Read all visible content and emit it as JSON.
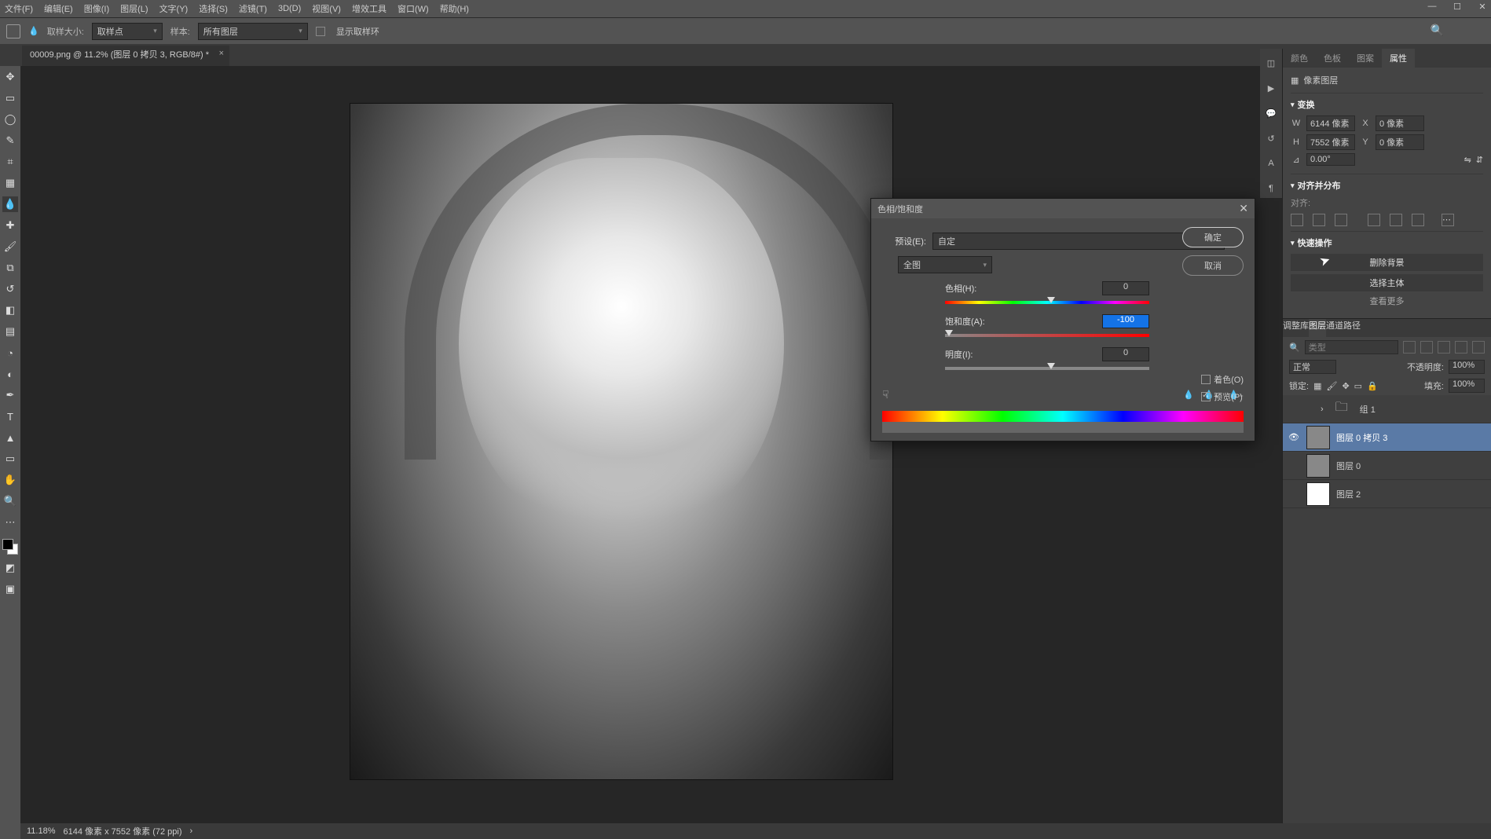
{
  "menu": {
    "file": "文件(F)",
    "edit": "编辑(E)",
    "image": "图像(I)",
    "layer": "图层(L)",
    "type": "文字(Y)",
    "select": "选择(S)",
    "filter": "滤镜(T)",
    "threeD": "3D(D)",
    "view": "视图(V)",
    "plugins": "增效工具",
    "window": "窗口(W)",
    "help": "帮助(H)"
  },
  "optbar": {
    "sampleSizeLabel": "取样大小:",
    "sampleSizeValue": "取样点",
    "sampleLabel": "样本:",
    "sampleValue": "所有图层",
    "showRing": "显示取样环"
  },
  "tab": {
    "title": "00009.png @ 11.2% (图层 0 拷贝 3, RGB/8#) *"
  },
  "dialog": {
    "title": "色相/饱和度",
    "presetLabel": "预设(E):",
    "presetValue": "自定",
    "channelValue": "全图",
    "hueLabel": "色相(H):",
    "hueValue": "0",
    "satLabel": "饱和度(A):",
    "satValue": "-100",
    "lightLabel": "明度(I):",
    "lightValue": "0",
    "ok": "确定",
    "cancel": "取消",
    "colorize": "着色(O)",
    "preview": "预览(P)"
  },
  "panels": {
    "tabs": {
      "color": "颜色",
      "swatch": "色板",
      "gradient": "图案",
      "props": "属性"
    },
    "pixelLayer": "像素图层",
    "transform": "变换",
    "w": "6144 像素",
    "h": "7552 像素",
    "x": "0 像素",
    "y": "0 像素",
    "angle": "0.00°",
    "alignDist": "对齐并分布",
    "alignLabel": "对齐:",
    "quickActions": "快速操作",
    "qa1": "删除背景",
    "qa2": "选择主体",
    "qa3": "查看更多",
    "tabs2": {
      "adjust": "调整",
      "lib": "库",
      "layers": "图层",
      "channels": "通道",
      "paths": "路径"
    },
    "layerSearchPh": "类型",
    "blend": "正常",
    "opacityLabel": "不透明度:",
    "opacityVal": "100%",
    "lockLabel": "锁定:",
    "fillLabel": "填充:",
    "fillVal": "100%",
    "layers": [
      {
        "name": "组 1",
        "type": "group"
      },
      {
        "name": "图层 0 拷贝 3",
        "type": "img",
        "sel": true,
        "vis": true
      },
      {
        "name": "图层 0",
        "type": "img"
      },
      {
        "name": "图层 2",
        "type": "white"
      }
    ]
  },
  "status": {
    "zoom": "11.18%",
    "dims": "6144 像素 x 7552 像素 (72 ppi)"
  }
}
